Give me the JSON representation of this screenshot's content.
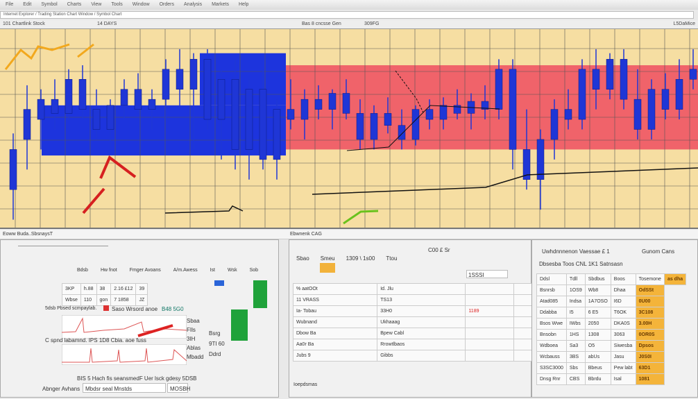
{
  "menu": [
    "File",
    "Edit",
    "Symbol",
    "Charts",
    "View",
    "Tools",
    "Window",
    "Orders",
    "Analysis",
    "Markets",
    "Help"
  ],
  "address": "Internet Explorer / Trading Station Chart Window / Symbol Chart",
  "chart_header": {
    "left": "101 Chartlink Stock",
    "mid": "14 DAYS",
    "center": "Bas 8 cncsse Gen",
    "center2": "309FG",
    "right": "L5DaMice"
  },
  "bottom_bar": {
    "left_title": "Eoww Buda..SbsnaysT",
    "mid_title": "Ebwnenk CAG",
    "mid_panel_title": "C00 £ Sr",
    "right_panel_title": "Uwhdnnnenon Vaessae £ 1",
    "right_panel_title2": "Gunom Cans"
  },
  "left_panel": {
    "header": [
      "Bdsb",
      "Hw fnot",
      "Fmger Avoans",
      "A/m.Awess",
      "Ist",
      "Wsk",
      "Sob"
    ],
    "rows": [
      [
        "3KP",
        "h.88",
        "38",
        "2.16 £12",
        "39"
      ],
      [
        "Wbse",
        "110",
        "gon",
        "7 1858",
        "JZ"
      ]
    ],
    "row2_label": "5dsb Pbsed scmpaylab.",
    "row2_tags": [
      "Saso Wrsord anoe",
      "B48 5G0"
    ],
    "row2_vals": [
      "Sbaa",
      "FIls",
      "3IH",
      "Ablas",
      "Mbadd"
    ],
    "row3_label": "C spnd labamnd. IPS 1D8  Cbia. aoe fuss",
    "row3_vals": [
      "Bsrg",
      "9TI 60",
      "Ddrd"
    ],
    "footer": "BIS 5 Hach fis seansmedF Uer lsck gdesy 5DSB",
    "footer_field": "Mbdsr seal Mnstds",
    "footer_btn": "MOSBH",
    "sub": "Abnger Avhans"
  },
  "mid_panel": {
    "tabs": [
      "Sbao",
      "Smeu",
      "1309 \\ 1s00",
      "Ttou"
    ],
    "search_value": "1SSSI",
    "rows": [
      [
        "% aatOOt",
        "Id. Jlu"
      ],
      [
        "11 VRASS",
        "TS13"
      ],
      [
        "Ia- Tobau",
        "33H0"
      ],
      [
        "Wubnand",
        "Ukhaaag"
      ],
      [
        "Dbow Ba",
        "Bpew Cabl"
      ],
      [
        "Aa0r Ba",
        "Rrowtlbaos"
      ],
      [
        "Jubs 9",
        "Gibbs"
      ]
    ],
    "red_value": "1189",
    "orders_label": "Ioepdsmas"
  },
  "right_panel": {
    "toolbar": "Dbsesba Toos CNL 1K1 Satnsasn",
    "headers": [
      "Ddsl",
      "Tdll",
      "Sbdbus",
      "Boos",
      "Tosemone",
      "as dha"
    ],
    "rows": [
      [
        "Bsnrsb",
        "1OS9",
        "Wb8",
        "Dhaa",
        "OdSSt"
      ],
      [
        "Atad085",
        "Indsa",
        "1A7OSO",
        "I6D",
        "0U00"
      ],
      [
        "Ddabba",
        "I5",
        "6 E5",
        "T6OK",
        "3C108"
      ],
      [
        "Bsos Wwe",
        "IWbs",
        "2050",
        "DKA0S",
        "3.00H"
      ],
      [
        "Bnsobn",
        "1HS",
        "1308",
        "3063",
        "0OR0S"
      ],
      [
        "Wdboea",
        "Sa3",
        "O5",
        "Siwesba",
        "Dpsos"
      ],
      [
        "Wcbauss",
        "3BS",
        "abUs",
        "Jasu",
        "J0S0I"
      ],
      [
        "S3SC3000",
        "Sbs",
        "Bbeus",
        "Pew labt",
        "63D1"
      ],
      [
        "Dnsg Rnr",
        "CBS",
        "Bbrdu",
        "Isal",
        "1081"
      ]
    ]
  },
  "chart_data": {
    "type": "candlestick",
    "title": "",
    "ylim": [
      0,
      100
    ],
    "candles": [
      [
        40,
        48,
        5,
        20
      ],
      [
        60,
        72,
        30,
        45
      ],
      [
        55,
        70,
        40,
        65
      ],
      [
        65,
        75,
        50,
        58
      ],
      [
        58,
        80,
        55,
        75
      ],
      [
        75,
        82,
        55,
        60
      ],
      [
        60,
        70,
        45,
        50
      ],
      [
        50,
        65,
        40,
        62
      ],
      [
        62,
        75,
        55,
        70
      ],
      [
        70,
        78,
        58,
        60
      ],
      [
        60,
        70,
        50,
        65
      ],
      [
        65,
        85,
        55,
        80
      ],
      [
        80,
        90,
        60,
        70
      ],
      [
        70,
        88,
        40,
        85
      ],
      [
        85,
        90,
        50,
        55
      ],
      [
        55,
        80,
        35,
        75
      ],
      [
        75,
        85,
        30,
        40
      ],
      [
        40,
        75,
        25,
        70
      ],
      [
        70,
        80,
        30,
        35
      ],
      [
        35,
        65,
        25,
        60
      ],
      [
        60,
        75,
        50,
        55
      ],
      [
        55,
        70,
        45,
        65
      ],
      [
        65,
        72,
        55,
        60
      ],
      [
        60,
        70,
        50,
        68
      ],
      [
        68,
        75,
        55,
        58
      ],
      [
        58,
        65,
        40,
        45
      ],
      [
        45,
        62,
        40,
        58
      ],
      [
        58,
        66,
        48,
        52
      ],
      [
        52,
        60,
        40,
        45
      ],
      [
        45,
        62,
        42,
        60
      ],
      [
        60,
        65,
        50,
        55
      ],
      [
        55,
        66,
        50,
        62
      ],
      [
        62,
        70,
        55,
        58
      ],
      [
        58,
        68,
        50,
        64
      ],
      [
        64,
        72,
        55,
        60
      ],
      [
        60,
        85,
        55,
        80
      ],
      [
        80,
        85,
        30,
        40
      ],
      [
        40,
        60,
        20,
        25
      ],
      [
        25,
        50,
        10,
        45
      ],
      [
        45,
        65,
        35,
        60
      ],
      [
        60,
        70,
        50,
        55
      ],
      [
        55,
        85,
        50,
        80
      ],
      [
        80,
        90,
        60,
        70
      ],
      [
        70,
        88,
        65,
        85
      ],
      [
        85,
        90,
        60,
        65
      ],
      [
        65,
        80,
        45,
        50
      ],
      [
        50,
        75,
        45,
        70
      ],
      [
        70,
        78,
        55,
        60
      ],
      [
        60,
        85,
        55,
        75
      ],
      [
        75,
        90,
        70,
        80
      ]
    ],
    "colors": {
      "candle": "#1f36d6",
      "background": "#f6dea2",
      "zone_blue": "#1d34dd",
      "zone_red": "#f0636a"
    }
  }
}
